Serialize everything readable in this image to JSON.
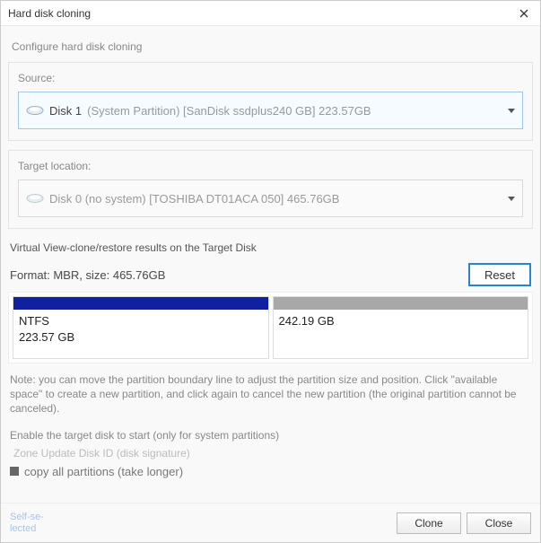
{
  "window": {
    "title": "Hard disk cloning"
  },
  "subtitle": "Configure hard disk cloning",
  "source": {
    "label": "Source:",
    "disk_name": "Disk 1",
    "disk_desc": "(System Partition) [SanDisk ssdplus240 GB] 223.57GB"
  },
  "target": {
    "label": "Target location:",
    "disk_name": "Disk 0 (no system) [TOSHIBA DT01ACA 050] 465.76GB"
  },
  "virtual_view_label": "Virtual View-clone/restore results on the Target Disk",
  "format_line": "Format: MBR, size: 465.76GB",
  "reset_label": "Reset",
  "partitions": [
    {
      "fs": "NTFS",
      "size": "223.57 GB"
    },
    {
      "fs": "",
      "size": "242.19 GB"
    }
  ],
  "note": "Note: you can move the partition boundary line to adjust the partition size and position. Click \"available space\" to create a new partition, and click again to cancel the new partition (the origi­nal partition cannot be canceled).",
  "enable_text": "Enable the target disk to start (only for system partitions)",
  "signature_text": "Zone Update Disk ID (disk signature)",
  "copy_all_label": "copy all partitions (take longer)",
  "footer": {
    "self_line1": "Self-se-",
    "self_line2": "lected",
    "clone": "Clone",
    "close": "Close"
  }
}
